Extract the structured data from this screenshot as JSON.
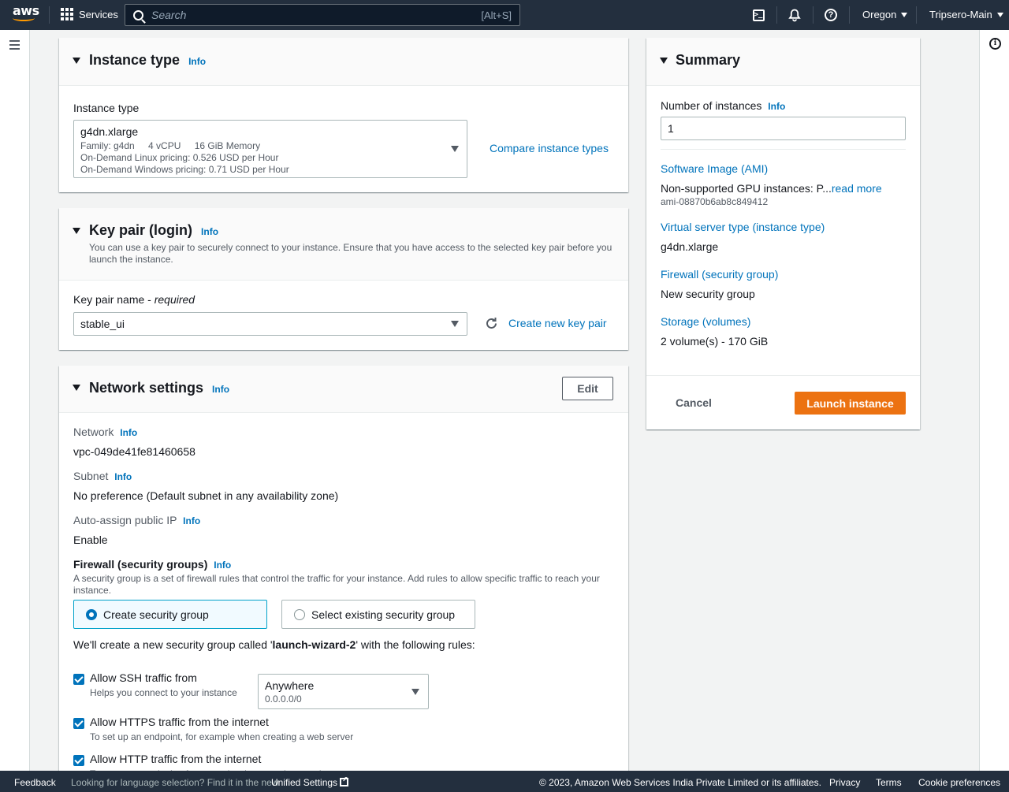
{
  "topnav": {
    "logo": "aws",
    "services_label": "Services",
    "search_placeholder": "Search",
    "search_shortcut": "[Alt+S]",
    "icons": [
      "cloudshell-icon",
      "bell-icon",
      "help-icon"
    ],
    "region": "Oregon",
    "account": "Tripsero-Main"
  },
  "instance_type": {
    "title": "Instance type",
    "info": "Info",
    "field_label": "Instance type",
    "selected": "g4dn.xlarge",
    "family": "Family: g4dn",
    "vcpu": "4 vCPU",
    "memory": "16 GiB Memory",
    "linux_pricing": "On-Demand Linux pricing: 0.526 USD per Hour",
    "windows_pricing": "On-Demand Windows pricing: 0.71 USD per Hour",
    "compare_link": "Compare instance types"
  },
  "key_pair": {
    "title": "Key pair (login)",
    "info": "Info",
    "description": "You can use a key pair to securely connect to your instance. Ensure that you have access to the selected key pair before you launch the instance.",
    "field_label": "Key pair name - ",
    "field_required": "required",
    "selected": "stable_ui",
    "create_link": "Create new key pair"
  },
  "network": {
    "title": "Network settings",
    "info": "Info",
    "edit_label": "Edit",
    "network_label": "Network",
    "network_value": "vpc-049de41fe81460658",
    "subnet_label": "Subnet",
    "subnet_value": "No preference (Default subnet in any availability zone)",
    "public_ip_label": "Auto-assign public IP",
    "public_ip_value": "Enable",
    "firewall_label": "Firewall (security groups)",
    "firewall_desc": "A security group is a set of firewall rules that control the traffic for your instance. Add rules to allow specific traffic to reach your instance.",
    "options": [
      {
        "label": "Create security group",
        "selected": true
      },
      {
        "label": "Select existing security group",
        "selected": false
      }
    ],
    "create_msg_prefix": "We'll create a new security group called '",
    "group_name": "launch-wizard-2",
    "create_msg_suffix": "' with the following rules:",
    "rules": [
      {
        "label": "Allow SSH traffic from",
        "desc": "Helps you connect to your instance",
        "checked": true
      },
      {
        "label": "Allow HTTPS traffic from the internet",
        "desc": "To set up an endpoint, for example when creating a web server",
        "checked": true
      },
      {
        "label": "Allow HTTP traffic from the internet",
        "desc": "To set up an endpoint, for example when creating a web server",
        "checked": true
      }
    ],
    "ssh_source": "Anywhere",
    "ssh_cidr": "0.0.0.0/0"
  },
  "summary": {
    "title": "Summary",
    "instances_label": "Number of instances",
    "info": "Info",
    "instances_value": "1",
    "ami_label": "Software Image (AMI)",
    "ami_value": "Non-supported GPU instances: P...",
    "ami_read_more": "read more",
    "ami_id": "ami-08870b6ab8c849412",
    "type_label": "Virtual server type (instance type)",
    "type_value": "g4dn.xlarge",
    "firewall_label": "Firewall (security group)",
    "firewall_value": "New security group",
    "storage_label": "Storage (volumes)",
    "storage_value": "2 volume(s) - 170 GiB",
    "cancel_label": "Cancel",
    "launch_label": "Launch instance"
  },
  "footer": {
    "feedback": "Feedback",
    "language_msg": "Looking for language selection? Find it in the new",
    "unified_settings": "Unified Settings",
    "copyright": "© 2023, Amazon Web Services India Private Limited or its affiliates.",
    "privacy": "Privacy",
    "terms": "Terms",
    "cookies": "Cookie preferences"
  },
  "colors": {
    "nav_bg": "#232f3e",
    "link": "#0073bb",
    "primary": "#ec7211"
  }
}
